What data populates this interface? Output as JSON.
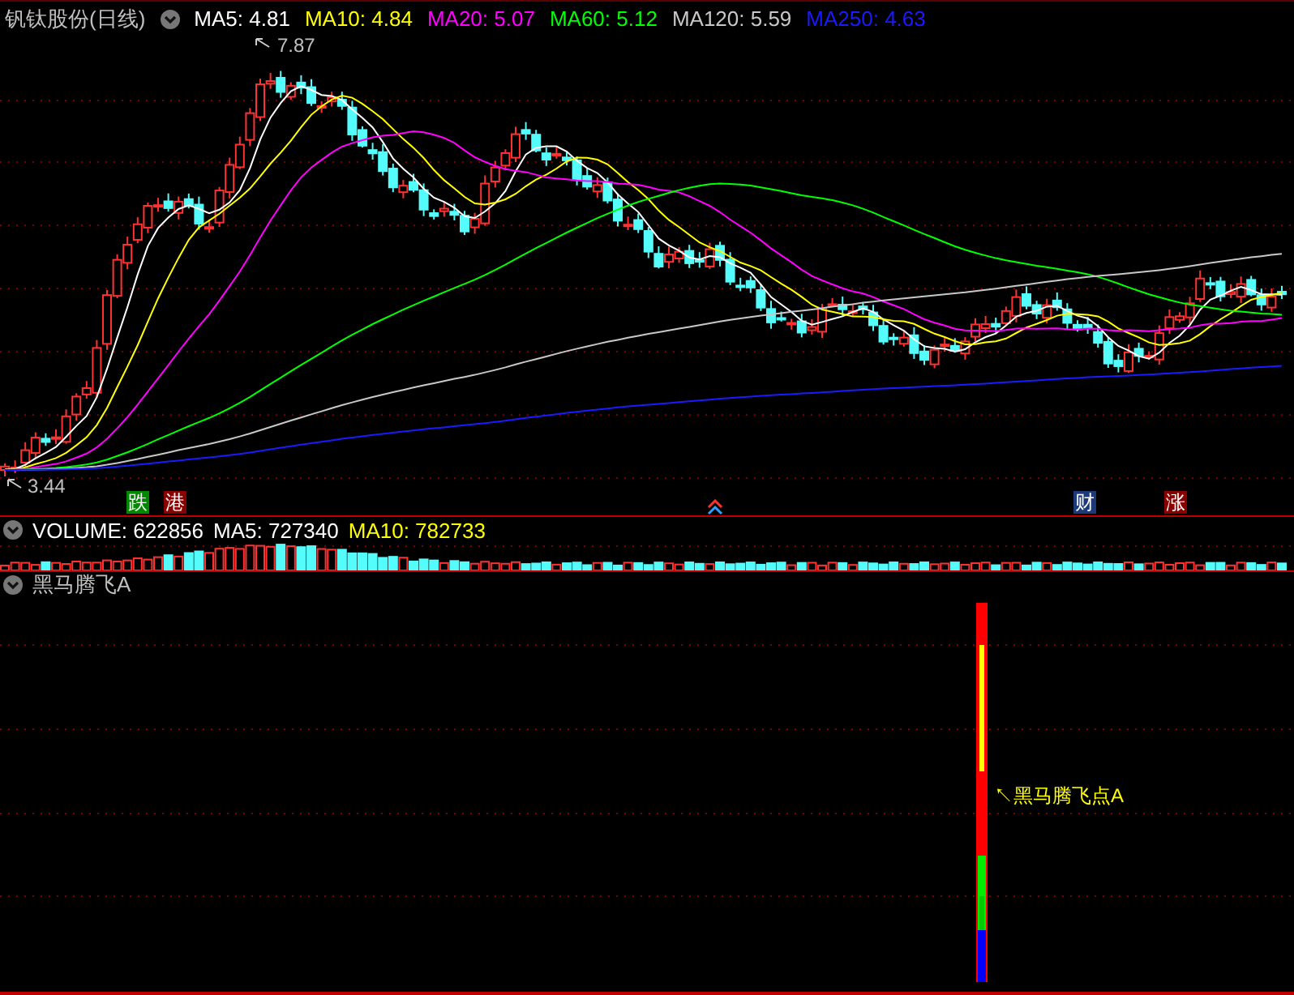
{
  "header": {
    "stock_name": "钒钛股份(日线)",
    "ma_legend": [
      {
        "label": "MA5: 4.81",
        "color": "#ffffff"
      },
      {
        "label": "MA10: 4.84",
        "color": "#ffff00"
      },
      {
        "label": "MA20: 5.07",
        "color": "#ff00ff"
      },
      {
        "label": "MA60: 5.12",
        "color": "#00ff00"
      },
      {
        "label": "MA120: 5.59",
        "color": "#c8c8c8"
      },
      {
        "label": "MA250: 4.63",
        "color": "#1a1aff"
      }
    ]
  },
  "price_chart": {
    "high_label": "7.87",
    "low_label": "3.44",
    "markers": [
      {
        "text": "跌",
        "color": "#008800"
      },
      {
        "text": "港",
        "color": "#880000"
      },
      {
        "text": "财",
        "color": "#1c3a7a"
      },
      {
        "text": "涨",
        "color": "#880000"
      }
    ]
  },
  "volume": {
    "legend": [
      {
        "label": "VOLUME: 622856",
        "color": "#ffffff"
      },
      {
        "label": "MA5: 727340",
        "color": "#ffffff"
      },
      {
        "label": "MA10: 782733",
        "color": "#ffff00"
      }
    ]
  },
  "indicator": {
    "title": "黑马腾飞A",
    "signal_label": "↖黑马腾飞点A"
  }
}
